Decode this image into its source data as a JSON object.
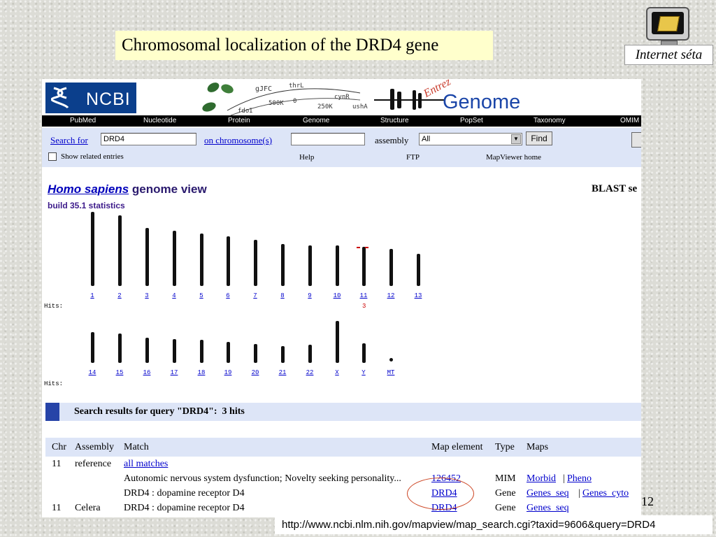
{
  "slide": {
    "title": "Chromosomal localization of the DRD4 gene",
    "logo_caption": "Internet séta",
    "page_number": "12",
    "url": "http://www.ncbi.nlm.nih.gov/mapview/map_search.cgi?taxid=9606&query=DRD4"
  },
  "ncbi": {
    "logo_text": "NCBI",
    "entrez_text": "Entrez",
    "genome_text": "Genome",
    "banner_labels": [
      "gJFC",
      "thrL",
      "cynR",
      "ushA",
      "fdoI",
      "500K",
      "250K",
      "0"
    ]
  },
  "navbar": {
    "items": [
      "PubMed",
      "Nucleotide",
      "Protein",
      "Genome",
      "Structure",
      "PopSet",
      "Taxonomy",
      "OMIM"
    ]
  },
  "search": {
    "search_for_label": "Search for",
    "query_value": "DRD4",
    "chromosome_label": "on chromosome(s)",
    "chromosome_value": "",
    "assembly_label": "assembly",
    "assembly_value": "All",
    "find_label": "Find",
    "show_related_label": "Show related entries",
    "help_label": "Help",
    "ftp_label": "FTP",
    "mapviewer_home_label": "MapViewer home"
  },
  "genome_view": {
    "species": "Homo  sapiens",
    "title_rest": " genome view",
    "blast_label": "BLAST se",
    "build_label": "build 35.1 statistics",
    "hits_label": "Hits:",
    "row1": {
      "labels": [
        "1",
        "2",
        "3",
        "4",
        "5",
        "6",
        "7",
        "8",
        "9",
        "10",
        "11",
        "12",
        "13"
      ],
      "hit_chromosome": "11",
      "hit_count": "3"
    },
    "row2": {
      "labels": [
        "14",
        "15",
        "16",
        "17",
        "18",
        "19",
        "20",
        "21",
        "22",
        "X",
        "Y",
        "MT"
      ]
    }
  },
  "results": {
    "prefix": "Search results for query \"DRD4\":",
    "hits": "3 hits",
    "columns": [
      "Chr",
      "Assembly",
      "Match",
      "Map element",
      "Type",
      "Maps"
    ],
    "rows": [
      {
        "chr": "11",
        "assembly": "reference",
        "match": "all matches",
        "map_element": "",
        "type": "",
        "maps": []
      },
      {
        "chr": "",
        "assembly": "",
        "match": "Autonomic nervous system dysfunction; Novelty seeking personality...",
        "map_element": "126452",
        "type": "MIM",
        "maps": [
          "Morbid",
          "Pheno"
        ]
      },
      {
        "chr": "",
        "assembly": "",
        "match": "DRD4 : dopamine receptor D4",
        "map_element": "DRD4",
        "type": "Gene",
        "maps": [
          "Genes_seq",
          "Genes_cyto"
        ]
      },
      {
        "chr": "11",
        "assembly": "Celera",
        "match": "DRD4 : dopamine receptor D4",
        "map_element": "DRD4",
        "type": "Gene",
        "maps": [
          "Genes_seq"
        ]
      }
    ]
  }
}
